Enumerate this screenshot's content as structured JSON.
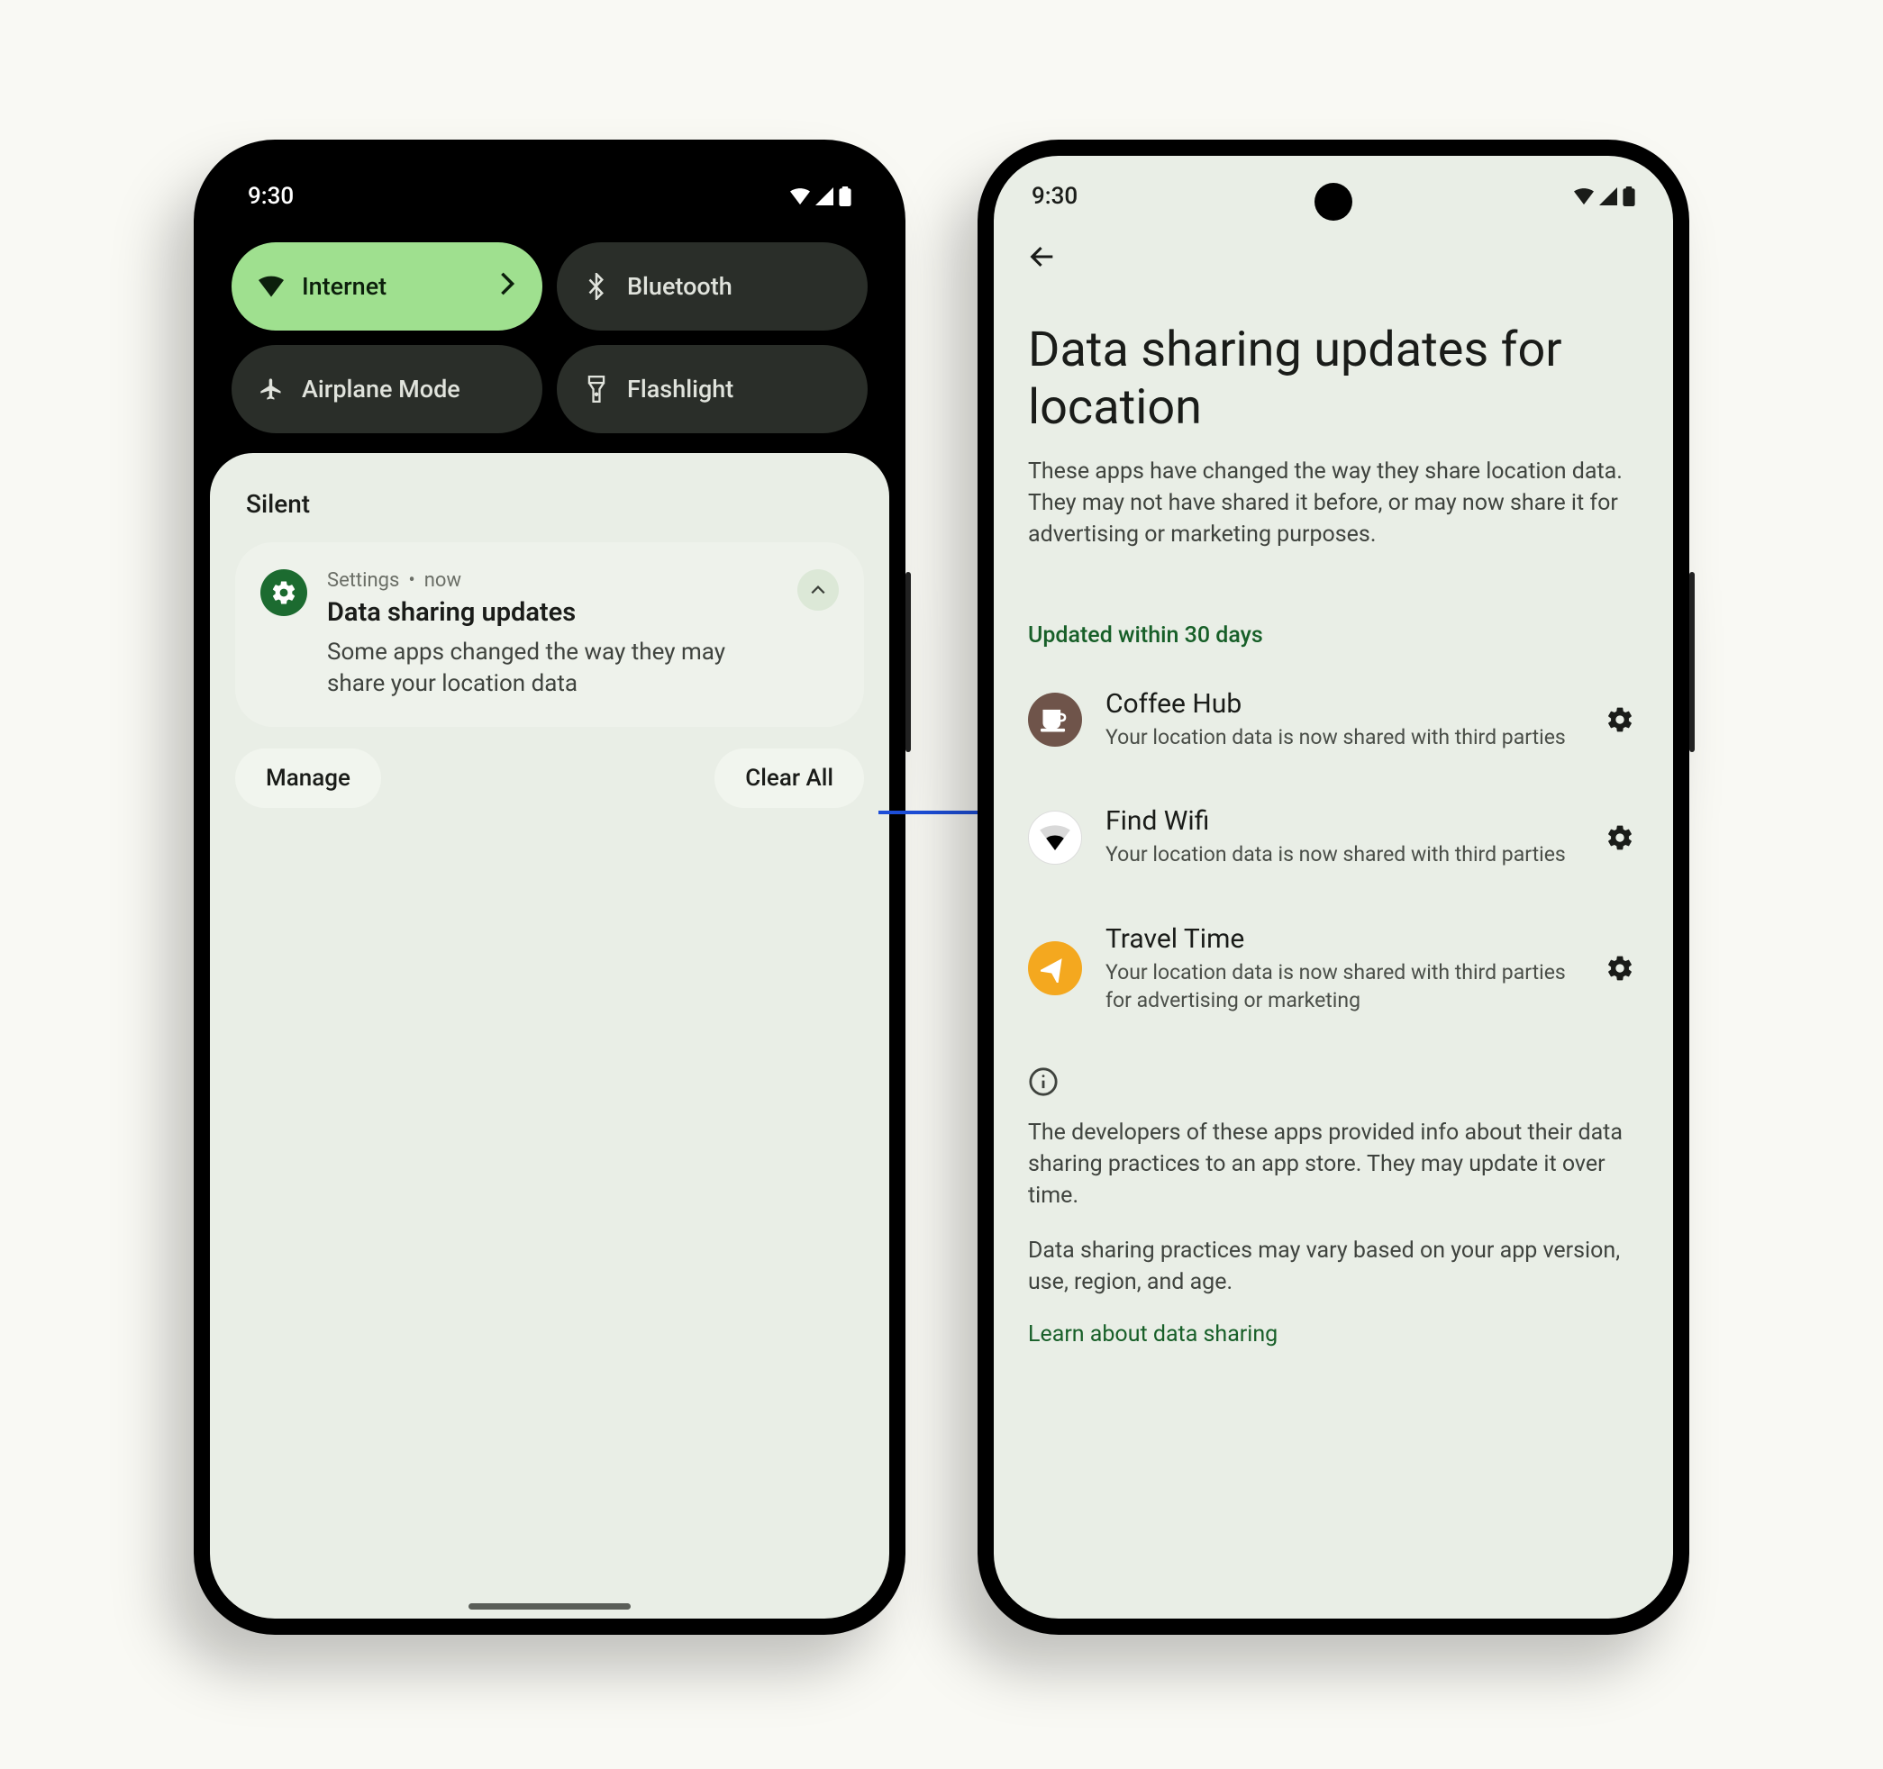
{
  "status": {
    "time": "9:30"
  },
  "phone1": {
    "qs": {
      "internet": "Internet",
      "bluetooth": "Bluetooth",
      "airplane": "Airplane Mode",
      "flashlight": "Flashlight"
    },
    "shade": {
      "silent_label": "Silent",
      "notif": {
        "app": "Settings",
        "when": "now",
        "title": "Data sharing updates",
        "body": "Some apps changed the way they may share your location data"
      },
      "manage": "Manage",
      "clear_all": "Clear All"
    }
  },
  "phone2": {
    "title": "Data sharing updates for location",
    "subtitle": "These apps have changed the way they share location data. They may not have shared it before, or may now share it for advertising or marketing purposes.",
    "section_label": "Updated within 30 days",
    "apps": [
      {
        "name": "Coffee Hub",
        "desc": "Your location data is now shared with third parties"
      },
      {
        "name": "Find Wifi",
        "desc": "Your location data is now shared with third parties"
      },
      {
        "name": "Travel Time",
        "desc": "Your location data is now shared with third parties for advertising or marketing"
      }
    ],
    "info1": "The developers of these apps provided info about their data sharing practices to an app store. They may update it over time.",
    "info2": "Data sharing practices may vary based on your app version, use, region, and age.",
    "learn": "Learn about data sharing"
  }
}
